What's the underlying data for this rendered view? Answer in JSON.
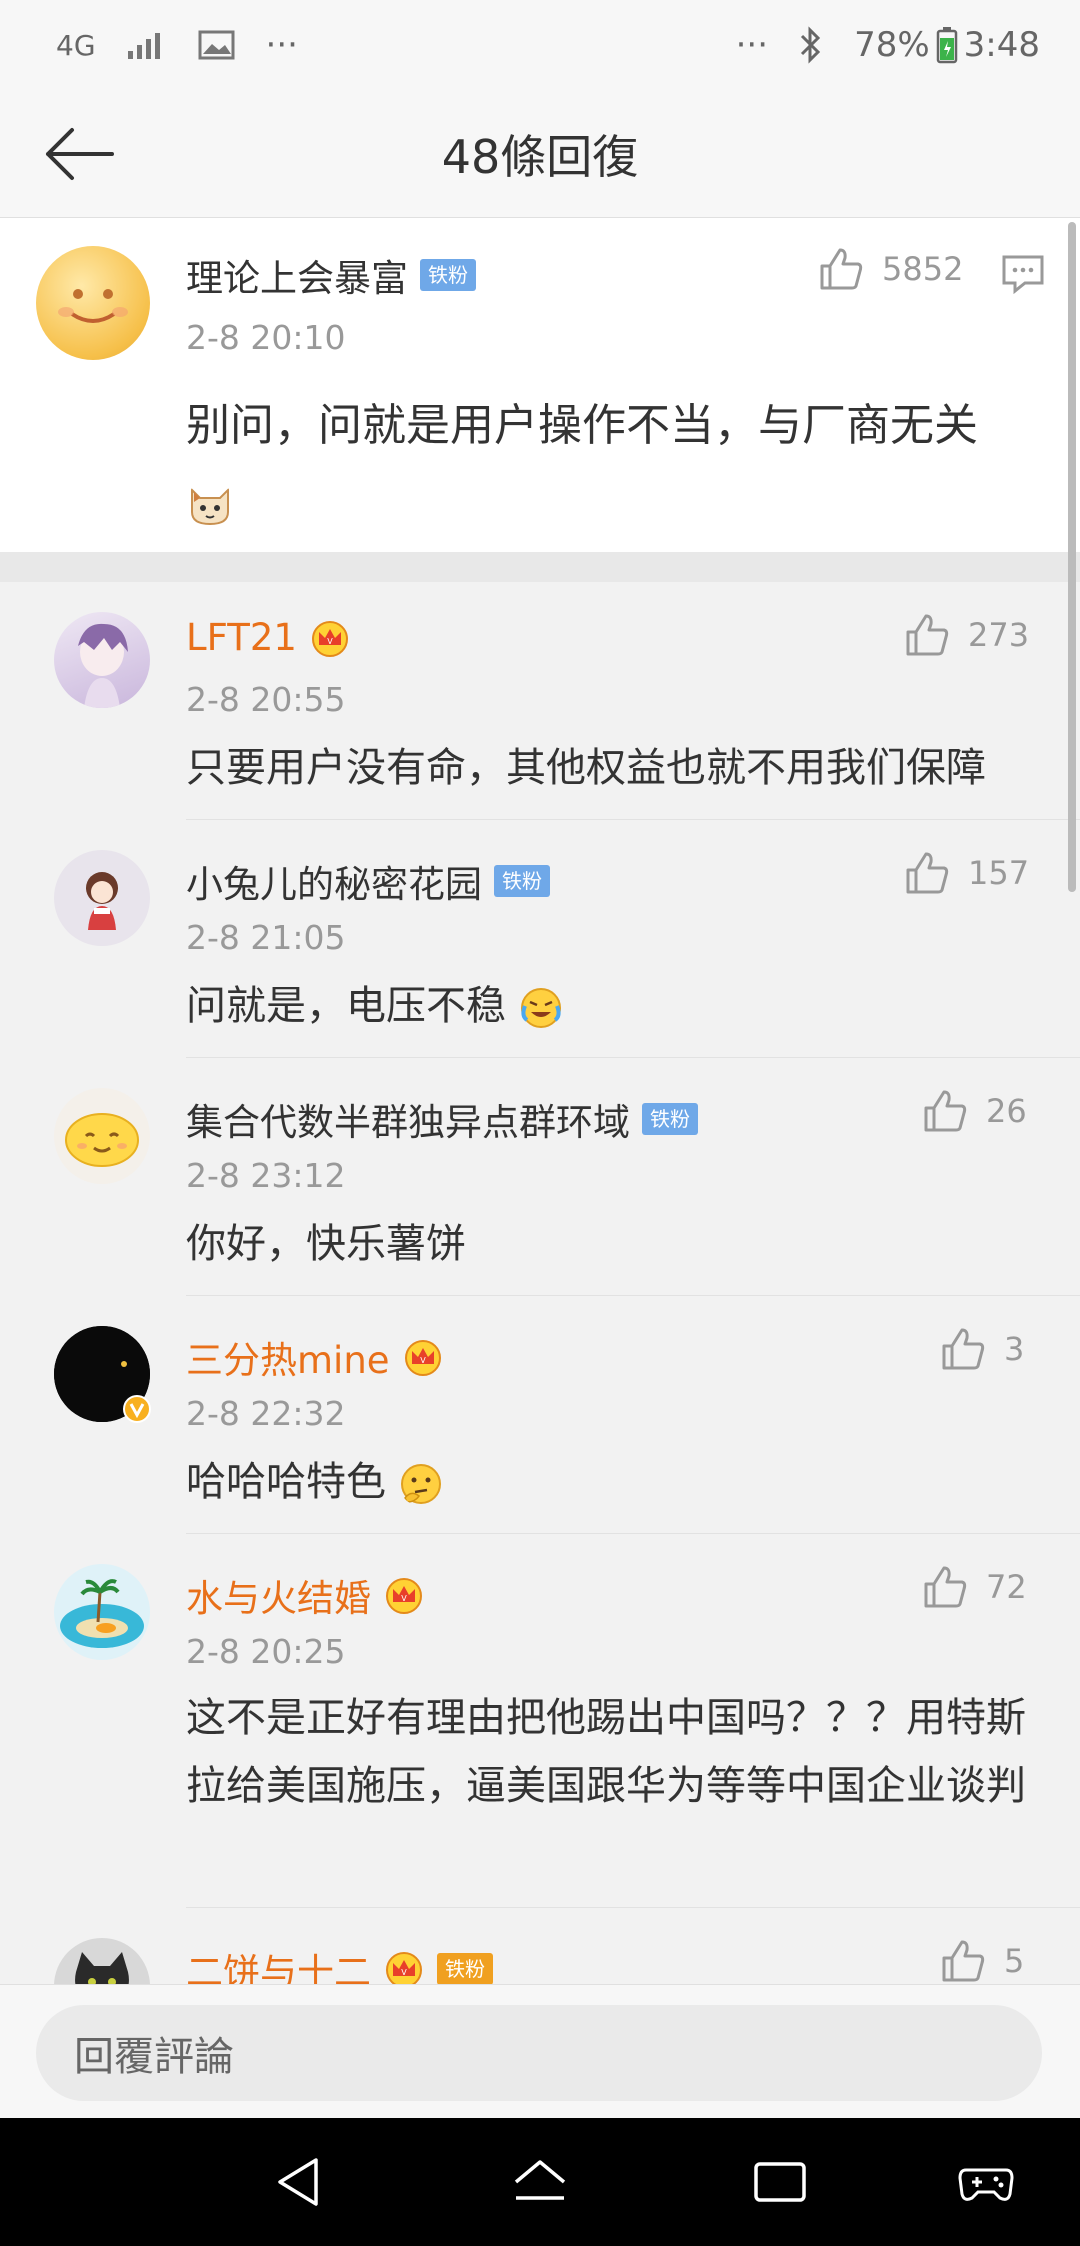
{
  "status_bar": {
    "network": "4G",
    "dots_left": "···",
    "dots_right": "···",
    "battery": "78%",
    "time": "3:48"
  },
  "header": {
    "title": "48條回復",
    "back_icon": "arrow-left-icon"
  },
  "root_comment": {
    "username": "理论上会暴富",
    "badge": "铁粉",
    "time": "2-8 20:10",
    "likes": "5852",
    "content": "别问，问就是用户操作不当，与厂商无关",
    "emoji_icon": "cat-face-emoji-icon"
  },
  "replies": [
    {
      "username": "LFT21",
      "name_color": "orange",
      "crown": true,
      "badge": "",
      "time": "2-8 20:55",
      "likes": "273",
      "content": "只要用户没有命，其他权益也就不用我们保障",
      "emoji_icon": ""
    },
    {
      "username": "小兔儿的秘密花园",
      "name_color": "gray",
      "crown": false,
      "badge": "铁粉",
      "time": "2-8 21:05",
      "likes": "157",
      "content": "问就是，电压不稳",
      "emoji_icon": "laugh-cry-emoji-icon"
    },
    {
      "username": "集合代数半群独异点群环域",
      "name_color": "gray",
      "crown": false,
      "badge": "铁粉",
      "time": "2-8 23:12",
      "likes": "26",
      "content": "你好，快乐薯饼",
      "emoji_icon": ""
    },
    {
      "username": "三分热mine",
      "name_color": "orange",
      "crown": true,
      "badge": "",
      "time": "2-8 22:32",
      "likes": "3",
      "content": "哈哈哈特色",
      "emoji_icon": "thinking-emoji-icon"
    },
    {
      "username": "水与火结婚",
      "name_color": "orange",
      "crown": true,
      "badge": "",
      "time": "2-8 20:25",
      "likes": "72",
      "content": "这不是正好有理由把他踢出中国吗？？？用特斯拉给美国施压，逼美国跟华为等等中国企业谈判",
      "emoji_icon": ""
    },
    {
      "username": "二饼与十二",
      "name_color": "orange",
      "crown": true,
      "badge": "铁粉",
      "time": "",
      "likes": "5",
      "content": "",
      "emoji_icon": ""
    }
  ],
  "reply_bar": {
    "placeholder": "回覆評論"
  },
  "colors": {
    "accent_orange": "#e8701a",
    "badge_blue": "#6fa8e8"
  }
}
